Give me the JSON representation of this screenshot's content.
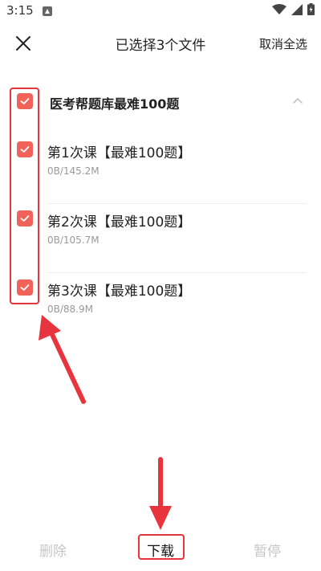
{
  "status": {
    "time": "3:15"
  },
  "header": {
    "title": "已选择3个文件",
    "cancel_all_label": "取消全选"
  },
  "group": {
    "title": "医考帮题库最难100题",
    "checked": true,
    "expanded": true
  },
  "items": [
    {
      "title": "第1次课【最难100题】",
      "size": "0B/145.2M",
      "checked": true
    },
    {
      "title": "第2次课【最难100题】",
      "size": "0B/105.7M",
      "checked": true
    },
    {
      "title": "第3次课【最难100题】",
      "size": "0B/88.9M",
      "checked": true
    }
  ],
  "bottom": {
    "delete_label": "删除",
    "download_label": "下载",
    "pause_label": "暂停"
  },
  "colors": {
    "checkbox": "#f0625a",
    "annotation": "#e8343c",
    "disabled_text": "#c6c6c6"
  },
  "icons": [
    "close-icon",
    "chevron-up-icon",
    "check-icon",
    "wifi-icon",
    "signal-icon",
    "battery-icon",
    "notification-icon"
  ]
}
